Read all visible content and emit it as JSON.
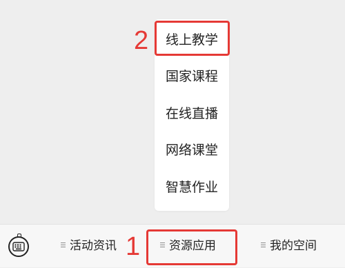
{
  "popup_menu": {
    "items": [
      "线上教学",
      "国家课程",
      "在线直播",
      "网络课堂",
      "智慧作业"
    ]
  },
  "annotations": {
    "step_1": "1",
    "step_2": "2",
    "highlight_color": "#e53935"
  },
  "bottom_bar": {
    "keyboard_icon": "keyboard-icon",
    "tabs": [
      {
        "label": "活动资讯",
        "icon": "menu-icon"
      },
      {
        "label": "资源应用",
        "icon": "menu-icon"
      },
      {
        "label": "我的空间",
        "icon": "menu-icon"
      }
    ]
  }
}
